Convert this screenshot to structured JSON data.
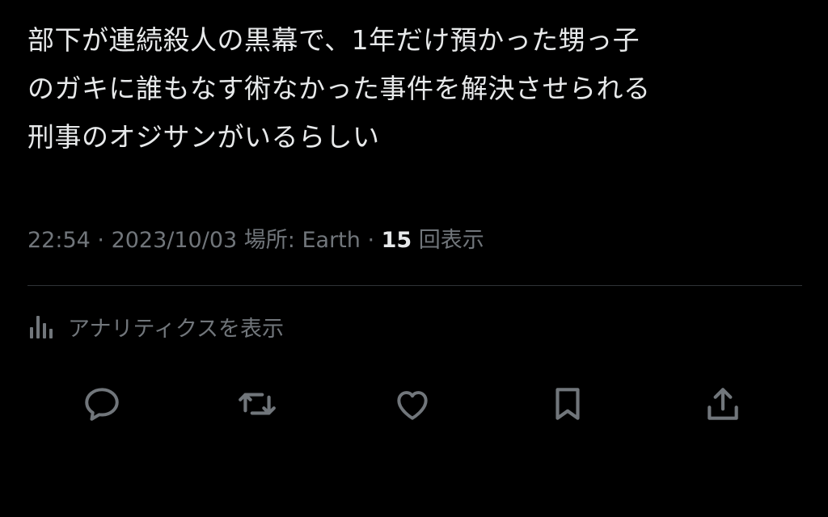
{
  "tweet": {
    "lines": [
      "部下が連続殺人の黒幕で、1年だけ預かった甥っ子",
      "のガキに誰もなす術なかった事件を解決させられる",
      "刑事のオジサンがいるらしい"
    ]
  },
  "meta": {
    "time": "22:54",
    "separator": " · ",
    "date": "2023/10/03",
    "location_label": "場所: Earth",
    "views_count": "15",
    "views_label": "回表示"
  },
  "analytics": {
    "icon": "bar-chart-icon",
    "label": "アナリティクスを表示"
  },
  "actions": {
    "icons": [
      "reply-icon",
      "retweet-icon",
      "like-icon",
      "bookmark-icon",
      "share-icon"
    ]
  },
  "colors": {
    "background": "#000000",
    "primary_text": "#e7e9ea",
    "secondary_text": "#71767b",
    "divider": "#2f3336"
  }
}
